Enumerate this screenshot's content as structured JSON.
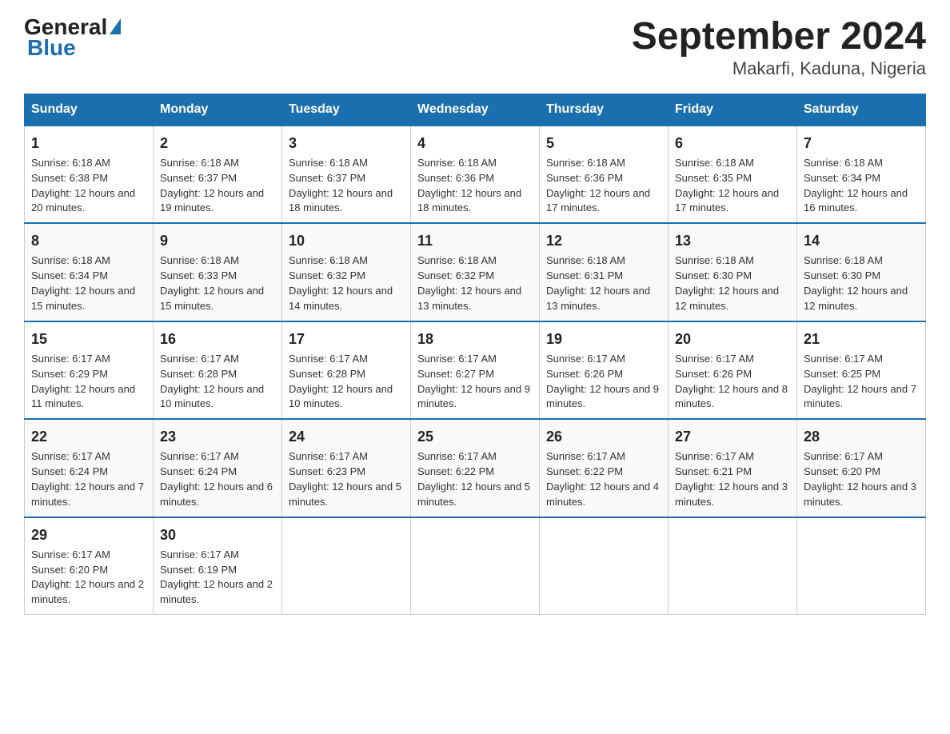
{
  "logo": {
    "text_general": "General",
    "text_blue": "Blue"
  },
  "title": "September 2024",
  "subtitle": "Makarfi, Kaduna, Nigeria",
  "columns": [
    "Sunday",
    "Monday",
    "Tuesday",
    "Wednesday",
    "Thursday",
    "Friday",
    "Saturday"
  ],
  "weeks": [
    [
      {
        "day": "1",
        "sunrise": "6:18 AM",
        "sunset": "6:38 PM",
        "daylight": "12 hours and 20 minutes."
      },
      {
        "day": "2",
        "sunrise": "6:18 AM",
        "sunset": "6:37 PM",
        "daylight": "12 hours and 19 minutes."
      },
      {
        "day": "3",
        "sunrise": "6:18 AM",
        "sunset": "6:37 PM",
        "daylight": "12 hours and 18 minutes."
      },
      {
        "day": "4",
        "sunrise": "6:18 AM",
        "sunset": "6:36 PM",
        "daylight": "12 hours and 18 minutes."
      },
      {
        "day": "5",
        "sunrise": "6:18 AM",
        "sunset": "6:36 PM",
        "daylight": "12 hours and 17 minutes."
      },
      {
        "day": "6",
        "sunrise": "6:18 AM",
        "sunset": "6:35 PM",
        "daylight": "12 hours and 17 minutes."
      },
      {
        "day": "7",
        "sunrise": "6:18 AM",
        "sunset": "6:34 PM",
        "daylight": "12 hours and 16 minutes."
      }
    ],
    [
      {
        "day": "8",
        "sunrise": "6:18 AM",
        "sunset": "6:34 PM",
        "daylight": "12 hours and 15 minutes."
      },
      {
        "day": "9",
        "sunrise": "6:18 AM",
        "sunset": "6:33 PM",
        "daylight": "12 hours and 15 minutes."
      },
      {
        "day": "10",
        "sunrise": "6:18 AM",
        "sunset": "6:32 PM",
        "daylight": "12 hours and 14 minutes."
      },
      {
        "day": "11",
        "sunrise": "6:18 AM",
        "sunset": "6:32 PM",
        "daylight": "12 hours and 13 minutes."
      },
      {
        "day": "12",
        "sunrise": "6:18 AM",
        "sunset": "6:31 PM",
        "daylight": "12 hours and 13 minutes."
      },
      {
        "day": "13",
        "sunrise": "6:18 AM",
        "sunset": "6:30 PM",
        "daylight": "12 hours and 12 minutes."
      },
      {
        "day": "14",
        "sunrise": "6:18 AM",
        "sunset": "6:30 PM",
        "daylight": "12 hours and 12 minutes."
      }
    ],
    [
      {
        "day": "15",
        "sunrise": "6:17 AM",
        "sunset": "6:29 PM",
        "daylight": "12 hours and 11 minutes."
      },
      {
        "day": "16",
        "sunrise": "6:17 AM",
        "sunset": "6:28 PM",
        "daylight": "12 hours and 10 minutes."
      },
      {
        "day": "17",
        "sunrise": "6:17 AM",
        "sunset": "6:28 PM",
        "daylight": "12 hours and 10 minutes."
      },
      {
        "day": "18",
        "sunrise": "6:17 AM",
        "sunset": "6:27 PM",
        "daylight": "12 hours and 9 minutes."
      },
      {
        "day": "19",
        "sunrise": "6:17 AM",
        "sunset": "6:26 PM",
        "daylight": "12 hours and 9 minutes."
      },
      {
        "day": "20",
        "sunrise": "6:17 AM",
        "sunset": "6:26 PM",
        "daylight": "12 hours and 8 minutes."
      },
      {
        "day": "21",
        "sunrise": "6:17 AM",
        "sunset": "6:25 PM",
        "daylight": "12 hours and 7 minutes."
      }
    ],
    [
      {
        "day": "22",
        "sunrise": "6:17 AM",
        "sunset": "6:24 PM",
        "daylight": "12 hours and 7 minutes."
      },
      {
        "day": "23",
        "sunrise": "6:17 AM",
        "sunset": "6:24 PM",
        "daylight": "12 hours and 6 minutes."
      },
      {
        "day": "24",
        "sunrise": "6:17 AM",
        "sunset": "6:23 PM",
        "daylight": "12 hours and 5 minutes."
      },
      {
        "day": "25",
        "sunrise": "6:17 AM",
        "sunset": "6:22 PM",
        "daylight": "12 hours and 5 minutes."
      },
      {
        "day": "26",
        "sunrise": "6:17 AM",
        "sunset": "6:22 PM",
        "daylight": "12 hours and 4 minutes."
      },
      {
        "day": "27",
        "sunrise": "6:17 AM",
        "sunset": "6:21 PM",
        "daylight": "12 hours and 3 minutes."
      },
      {
        "day": "28",
        "sunrise": "6:17 AM",
        "sunset": "6:20 PM",
        "daylight": "12 hours and 3 minutes."
      }
    ],
    [
      {
        "day": "29",
        "sunrise": "6:17 AM",
        "sunset": "6:20 PM",
        "daylight": "12 hours and 2 minutes."
      },
      {
        "day": "30",
        "sunrise": "6:17 AM",
        "sunset": "6:19 PM",
        "daylight": "12 hours and 2 minutes."
      },
      null,
      null,
      null,
      null,
      null
    ]
  ]
}
